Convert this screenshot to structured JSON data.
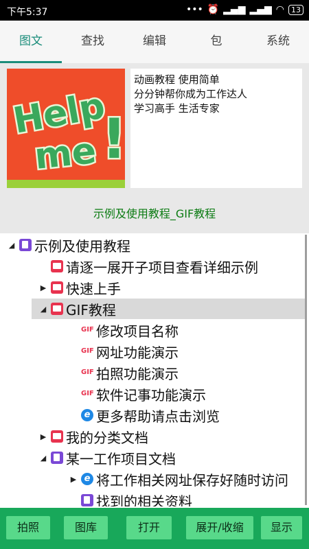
{
  "status_bar": {
    "time": "下午5:37",
    "battery": "13",
    "icons": [
      "dots-icon",
      "alarm-icon",
      "signal-icon",
      "signal-icon",
      "wifi-icon",
      "battery-icon"
    ]
  },
  "tabs": [
    {
      "label": "图文",
      "active": true
    },
    {
      "label": "查找",
      "active": false
    },
    {
      "label": "编辑",
      "active": false
    },
    {
      "label": "包",
      "active": false
    },
    {
      "label": "系统",
      "active": false
    }
  ],
  "info": {
    "image_text": "Help me!",
    "lines": [
      "动画教程 使用简单",
      "分分钟帮你成为工作达人",
      "学习高手 生活专家"
    ],
    "caption": "示例及使用教程_GIF教程"
  },
  "tree": [
    {
      "label": "示例及使用教程",
      "toggle": "expanded",
      "icon": "note-icon"
    },
    {
      "label": "请逐一展开子项目查看详细示例",
      "toggle": "none",
      "icon": "image-icon"
    },
    {
      "label": "快速上手",
      "toggle": "collapsed",
      "icon": "image-icon"
    },
    {
      "label": "GIF教程",
      "toggle": "expanded",
      "icon": "image-icon",
      "selected": true
    },
    {
      "label": "修改项目名称",
      "toggle": "none",
      "icon": "gif-icon"
    },
    {
      "label": "网址功能演示",
      "toggle": "none",
      "icon": "gif-icon"
    },
    {
      "label": "拍照功能演示",
      "toggle": "none",
      "icon": "gif-icon"
    },
    {
      "label": "软件记事功能演示",
      "toggle": "none",
      "icon": "gif-icon"
    },
    {
      "label": "更多帮助请点击浏览",
      "toggle": "none",
      "icon": "browser-icon"
    },
    {
      "label": "我的分类文档",
      "toggle": "collapsed",
      "icon": "image-icon"
    },
    {
      "label": "某一工作项目文档",
      "toggle": "expanded",
      "icon": "note-icon"
    },
    {
      "label": "将工作相关网址保存好随时访问",
      "toggle": "collapsed",
      "icon": "browser-icon"
    },
    {
      "label": "找到的相关资料",
      "toggle": "none",
      "icon": "note-icon"
    }
  ],
  "gif_icon_text": "GIF",
  "browser_icon_text": "e",
  "buttons": [
    {
      "label": "拍照"
    },
    {
      "label": "图库"
    },
    {
      "label": "打开"
    },
    {
      "label": "展开/收缩"
    },
    {
      "label": "显示"
    }
  ],
  "colors": {
    "accent": "#1a8c7a",
    "bottom_bar": "#18a85a",
    "button": "#58d98a",
    "caption": "#0b7b12"
  }
}
